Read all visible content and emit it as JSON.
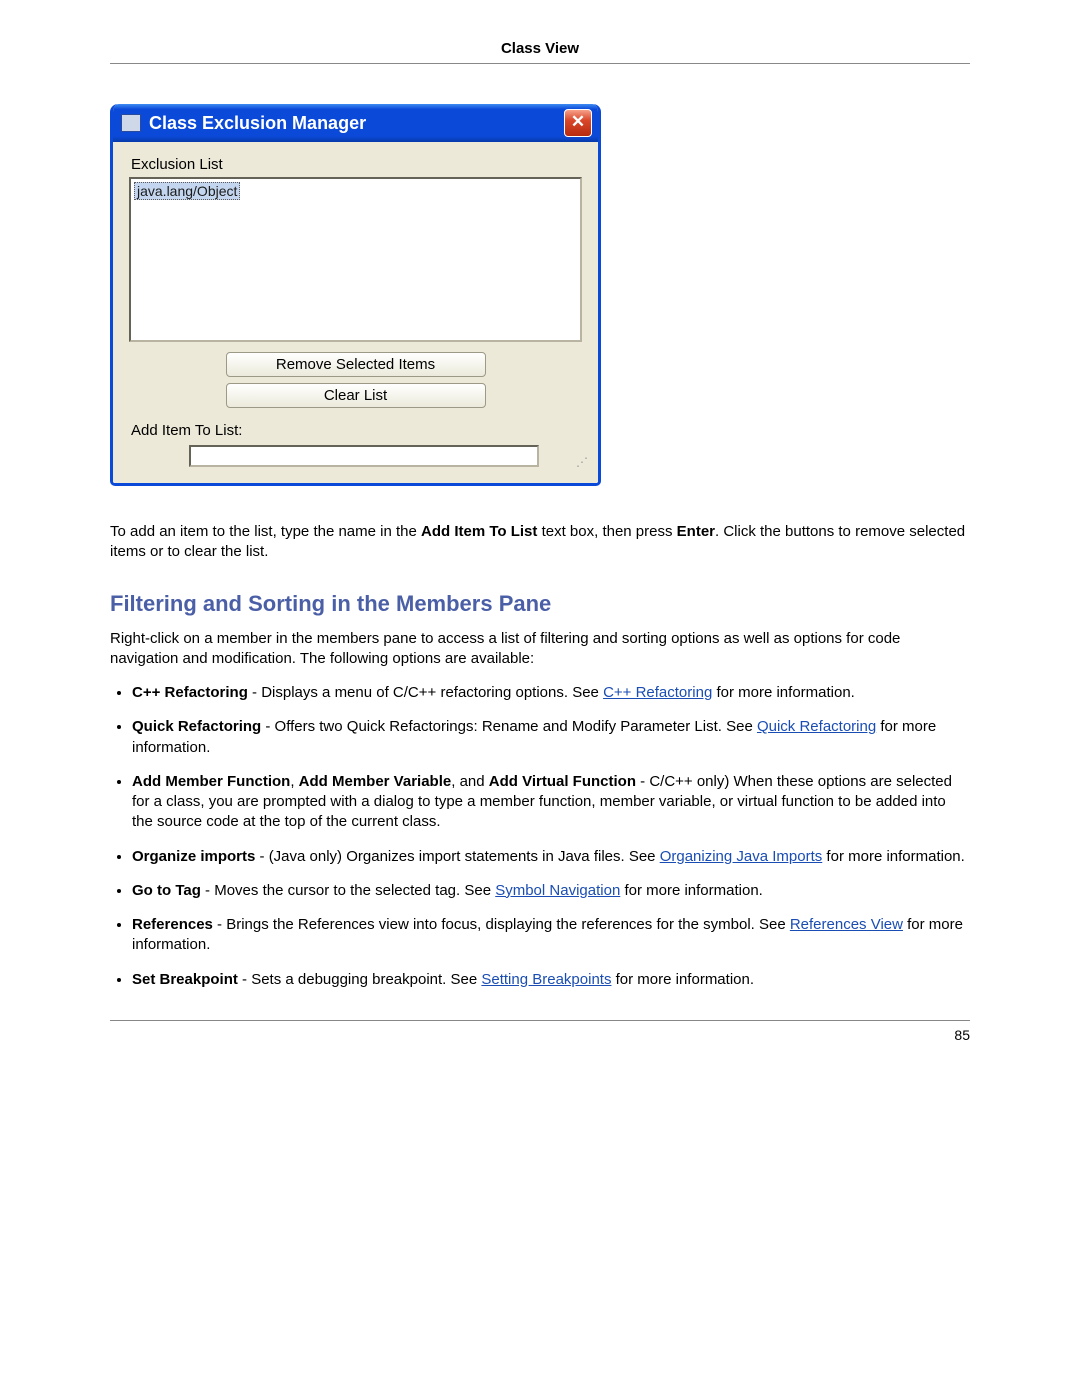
{
  "header": {
    "title": "Class View"
  },
  "dialog": {
    "title": "Class Exclusion Manager",
    "close_glyph": "✕",
    "exclusion_label": "Exclusion List",
    "list_item": "java.lang/Object",
    "btn_remove": "Remove Selected Items",
    "btn_clear": "Clear List",
    "add_label": "Add Item To List:",
    "add_value": ""
  },
  "para_after_dialog": {
    "p1a": "To add an item to the list, type the name in the ",
    "p1b_bold": "Add Item To List",
    "p1c": " text box, then press ",
    "p1d_bold": "Enter",
    "p1e": ". Click the buttons to remove selected items or to clear the list."
  },
  "section_title": "Filtering and Sorting in the Members Pane",
  "intro": "Right-click on a member in the members pane to access a list of filtering and sorting options as well as options for code navigation and modification. The following options are available:",
  "items": {
    "cpp_ref": {
      "bold": "C++ Refactoring",
      "mid": " - Displays a menu of C/C++ refactoring options. See ",
      "link": "C++ Refactoring",
      "tail": " for more information."
    },
    "quick_ref": {
      "bold": "Quick Refactoring",
      "mid": " - Offers two Quick Refactorings: Rename and Modify Parameter List. See ",
      "link": "Quick Refactoring",
      "tail": " for more information."
    },
    "add_member": {
      "b1": "Add Member Function",
      "s1": ", ",
      "b2": "Add Member Variable",
      "s2": ", and ",
      "b3": "Add Virtual Function",
      "tail": " - C/C++ only) When these options are selected for a class, you are prompted with a dialog to type a member function, member variable, or virtual function to be added into the source code at the top of the current class."
    },
    "organize": {
      "bold": "Organize imports",
      "mid": " - (Java only) Organizes import statements in Java files. See ",
      "link": "Organizing Java Imports",
      "tail": " for more information."
    },
    "gototag": {
      "bold": "Go to Tag",
      "mid": " - Moves the cursor to the selected tag. See ",
      "link": "Symbol Navigation",
      "tail": " for more information."
    },
    "references": {
      "bold": "References",
      "mid": " - Brings the References view into focus, displaying the references for the symbol. See ",
      "link": "References View",
      "tail": " for more information."
    },
    "breakpoint": {
      "bold": "Set Breakpoint",
      "mid": " - Sets a debugging breakpoint. See ",
      "link": "Setting Breakpoints",
      "tail": " for more information."
    }
  },
  "page_number": "85"
}
